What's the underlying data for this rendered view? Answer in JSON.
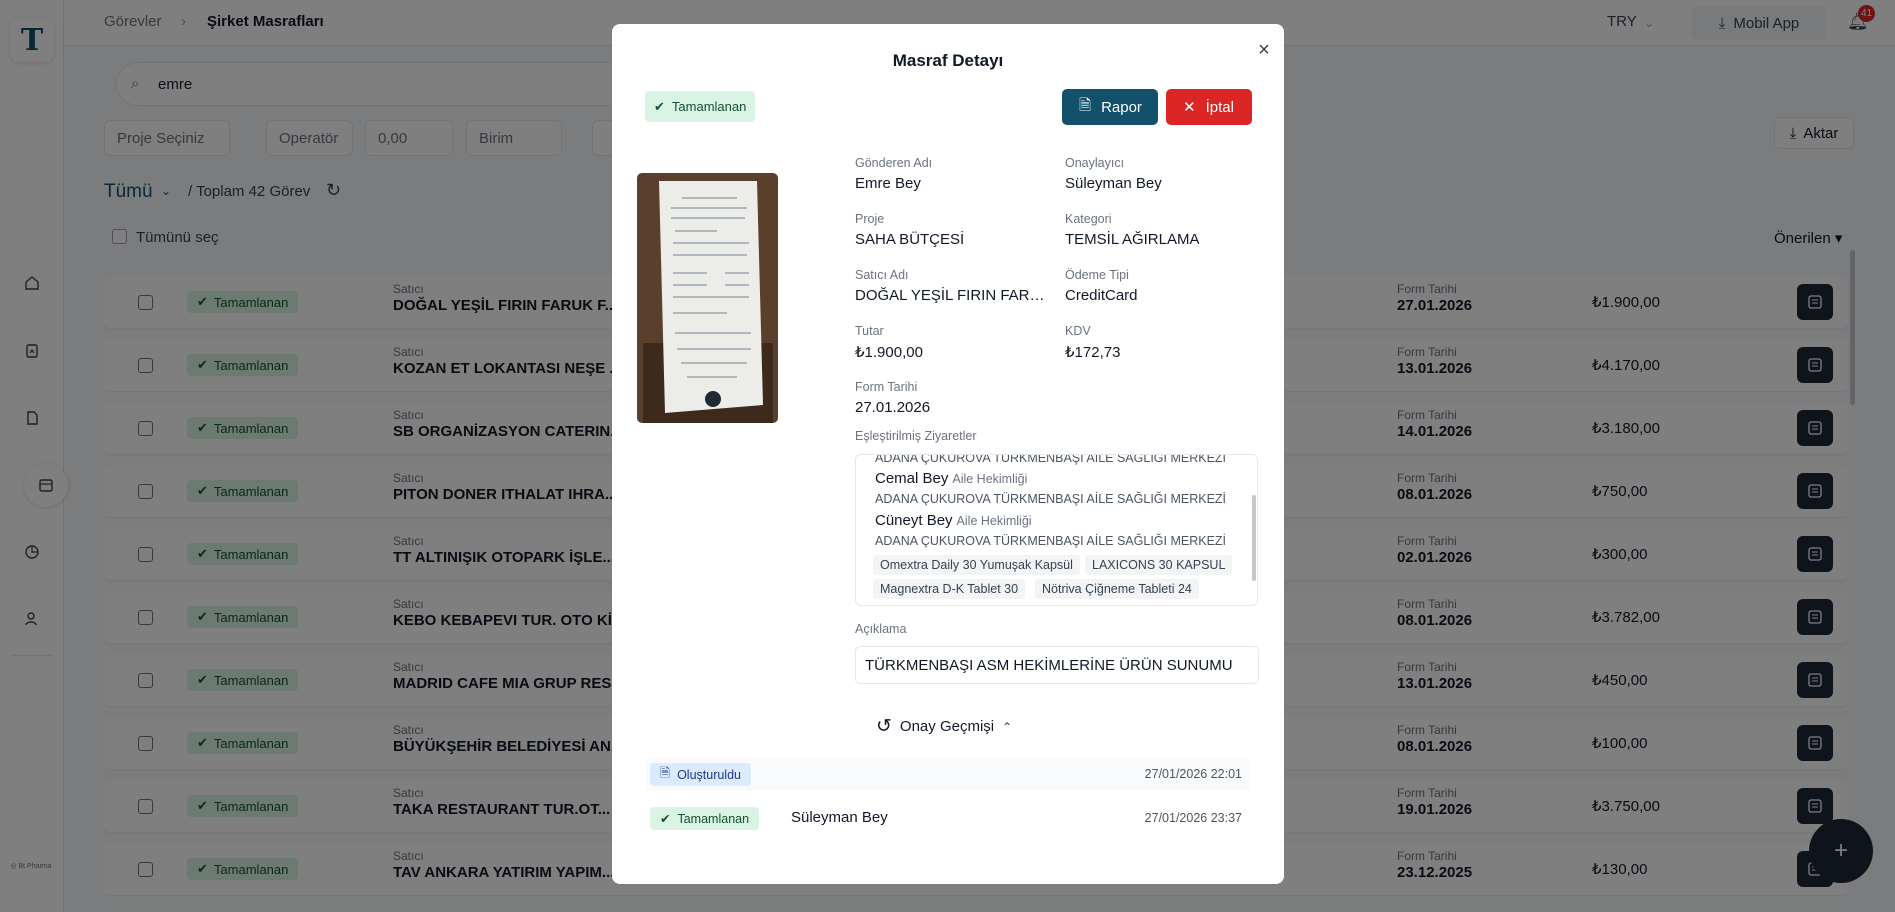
{
  "topbar": {
    "breadcrumb": [
      "Görevler",
      "Şirket Masrafları"
    ],
    "currency": "TRY",
    "mobile_app": "Mobil App",
    "notif_count": "41"
  },
  "search": {
    "value": "emre"
  },
  "filters": {
    "project": "Proje Seçiniz",
    "operator": "Operatör",
    "amount": "0,00",
    "unit": "Birim",
    "export": "Aktar"
  },
  "list": {
    "scope": "Tümü",
    "total": "/ Toplam 42 Görev",
    "select_all": "Tümünü seç",
    "sort": "Önerilen ▾",
    "vendor_label": "Satıcı",
    "date_label": "Form Tarihi"
  },
  "rows": [
    {
      "status": "Tamamlanan",
      "vendor": "DOĞAL YEŞİL FIRIN FARUK F...",
      "date": "27.01.2026",
      "amount": "₺1.900,00"
    },
    {
      "status": "Tamamlanan",
      "vendor": "KOZAN ET LOKANTASI NEŞE ...",
      "date": "13.01.2026",
      "amount": "₺4.170,00"
    },
    {
      "status": "Tamamlanan",
      "vendor": "SB ORGANİZASYON CATERIN...",
      "date": "14.01.2026",
      "amount": "₺3.180,00"
    },
    {
      "status": "Tamamlanan",
      "vendor": "PITON DONER ITHALAT IHRA...",
      "date": "08.01.2026",
      "amount": "₺750,00"
    },
    {
      "status": "Tamamlanan",
      "vendor": "TT ALTINIŞIK OTOPARK İŞLE...",
      "date": "02.01.2026",
      "amount": "₺300,00"
    },
    {
      "status": "Tamamlanan",
      "vendor": "KEBO KEBAPEVI TUR. OTO Kİ...",
      "date": "08.01.2026",
      "amount": "₺3.782,00"
    },
    {
      "status": "Tamamlanan",
      "vendor": "MADRID CAFE MIA GRUP RES...",
      "date": "13.01.2026",
      "amount": "₺450,00"
    },
    {
      "status": "Tamamlanan",
      "vendor": "BÜYÜKŞEHİR BELEDİYESİ AN...",
      "date": "08.01.2026",
      "amount": "₺100,00"
    },
    {
      "status": "Tamamlanan",
      "vendor": "TAKA RESTAURANT TUR.OT...",
      "date": "19.01.2026",
      "amount": "₺3.750,00"
    },
    {
      "status": "Tamamlanan",
      "vendor": "TAV ANKARA YATIRIM YAPIM...",
      "date": "23.12.2025",
      "amount": "₺130,00"
    }
  ],
  "modal": {
    "title": "Masraf Detayı",
    "status": "Tamamlanan",
    "report_btn": "Rapor",
    "cancel_btn": "İptal",
    "fields": [
      {
        "label": "Gönderen Adı",
        "value": "Emre Bey"
      },
      {
        "label": "Onaylayıcı",
        "value": "Süleyman Bey"
      },
      {
        "label": "Proje",
        "value": "SAHA BÜTÇESİ"
      },
      {
        "label": "Kategori",
        "value": "TEMSİL AĞIRLAMA"
      },
      {
        "label": "Satıcı Adı",
        "value": "DOĞAL YEŞİL FIRIN FARUK FIRINCI"
      },
      {
        "label": "Ödeme Tipi",
        "value": "CreditCard"
      },
      {
        "label": "Tutar",
        "value": "₺1.900,00"
      },
      {
        "label": "KDV",
        "value": "₺172,73"
      },
      {
        "label": "Form Tarihi",
        "value": "27.01.2026"
      }
    ],
    "visits_label": "Eşleştirilmiş Ziyaretler",
    "visits": {
      "top_sub": "ADANA ÇUKUROVA TÜRKMENBAŞI AİLE SAĞLIĞI MERKEZİ",
      "items": [
        {
          "name": "Cemal Bey",
          "role": "Aile Hekimliği",
          "sub": "ADANA ÇUKUROVA TÜRKMENBAŞI AİLE SAĞLIĞI MERKEZİ"
        },
        {
          "name": "Cüneyt Bey",
          "role": "Aile Hekimliği",
          "sub": "ADANA ÇUKUROVA TÜRKMENBAŞI AİLE SAĞLIĞI MERKEZİ"
        }
      ],
      "tags": [
        "Omextra Daily 30 Yumuşak Kapsül",
        "LAXICONS 30 KAPSUL",
        "Magnextra D-K Tablet 30",
        "Nötriva Çiğneme Tableti 24"
      ]
    },
    "desc_label": "Açıklama",
    "desc": "TÜRKMENBAŞI ASM HEKİMLERİNE ÜRÜN SUNUMU",
    "history_title": "Onay Geçmişi",
    "history": [
      {
        "status": "Oluşturuldu",
        "user": "",
        "time": "27/01/2026 22:01"
      },
      {
        "status": "Tamamlanan",
        "user": "Süleyman Bey",
        "time": "27/01/2026 23:37"
      }
    ]
  },
  "colors": {
    "primary": "#12506b",
    "danger": "#dc2626",
    "success_bg": "#d9f4e4",
    "info_bg": "#dbeafe"
  }
}
